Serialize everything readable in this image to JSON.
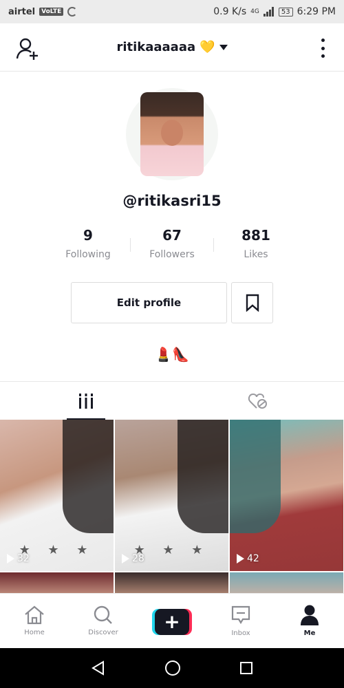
{
  "status_bar": {
    "carrier": "airtel",
    "volte": "VoLTE",
    "speed": "0.9 K/s",
    "network": "4G",
    "battery": "53",
    "time": "6:29 PM"
  },
  "header": {
    "username": "ritikaaaaaa",
    "username_emoji": "💛"
  },
  "profile": {
    "handle": "@ritikasri15",
    "bio": "💄👠",
    "edit_label": "Edit profile"
  },
  "stats": [
    {
      "value": "9",
      "label": "Following"
    },
    {
      "value": "67",
      "label": "Followers"
    },
    {
      "value": "881",
      "label": "Likes"
    }
  ],
  "tabs": [
    {
      "icon": "videos-grid-icon",
      "active": true
    },
    {
      "icon": "liked-videos-icon",
      "active": false
    }
  ],
  "videos": [
    {
      "views": "32"
    },
    {
      "views": "28"
    },
    {
      "views": "42"
    }
  ],
  "nav": [
    {
      "label": "Home",
      "icon": "home-icon"
    },
    {
      "label": "Discover",
      "icon": "search-icon"
    },
    {
      "label": "",
      "icon": "plus-icon"
    },
    {
      "label": "Inbox",
      "icon": "inbox-icon"
    },
    {
      "label": "Me",
      "icon": "profile-icon"
    }
  ],
  "colors": {
    "text": "#161823",
    "muted": "#8a8b91",
    "cyan": "#20d5ec",
    "red": "#fe2c55"
  }
}
